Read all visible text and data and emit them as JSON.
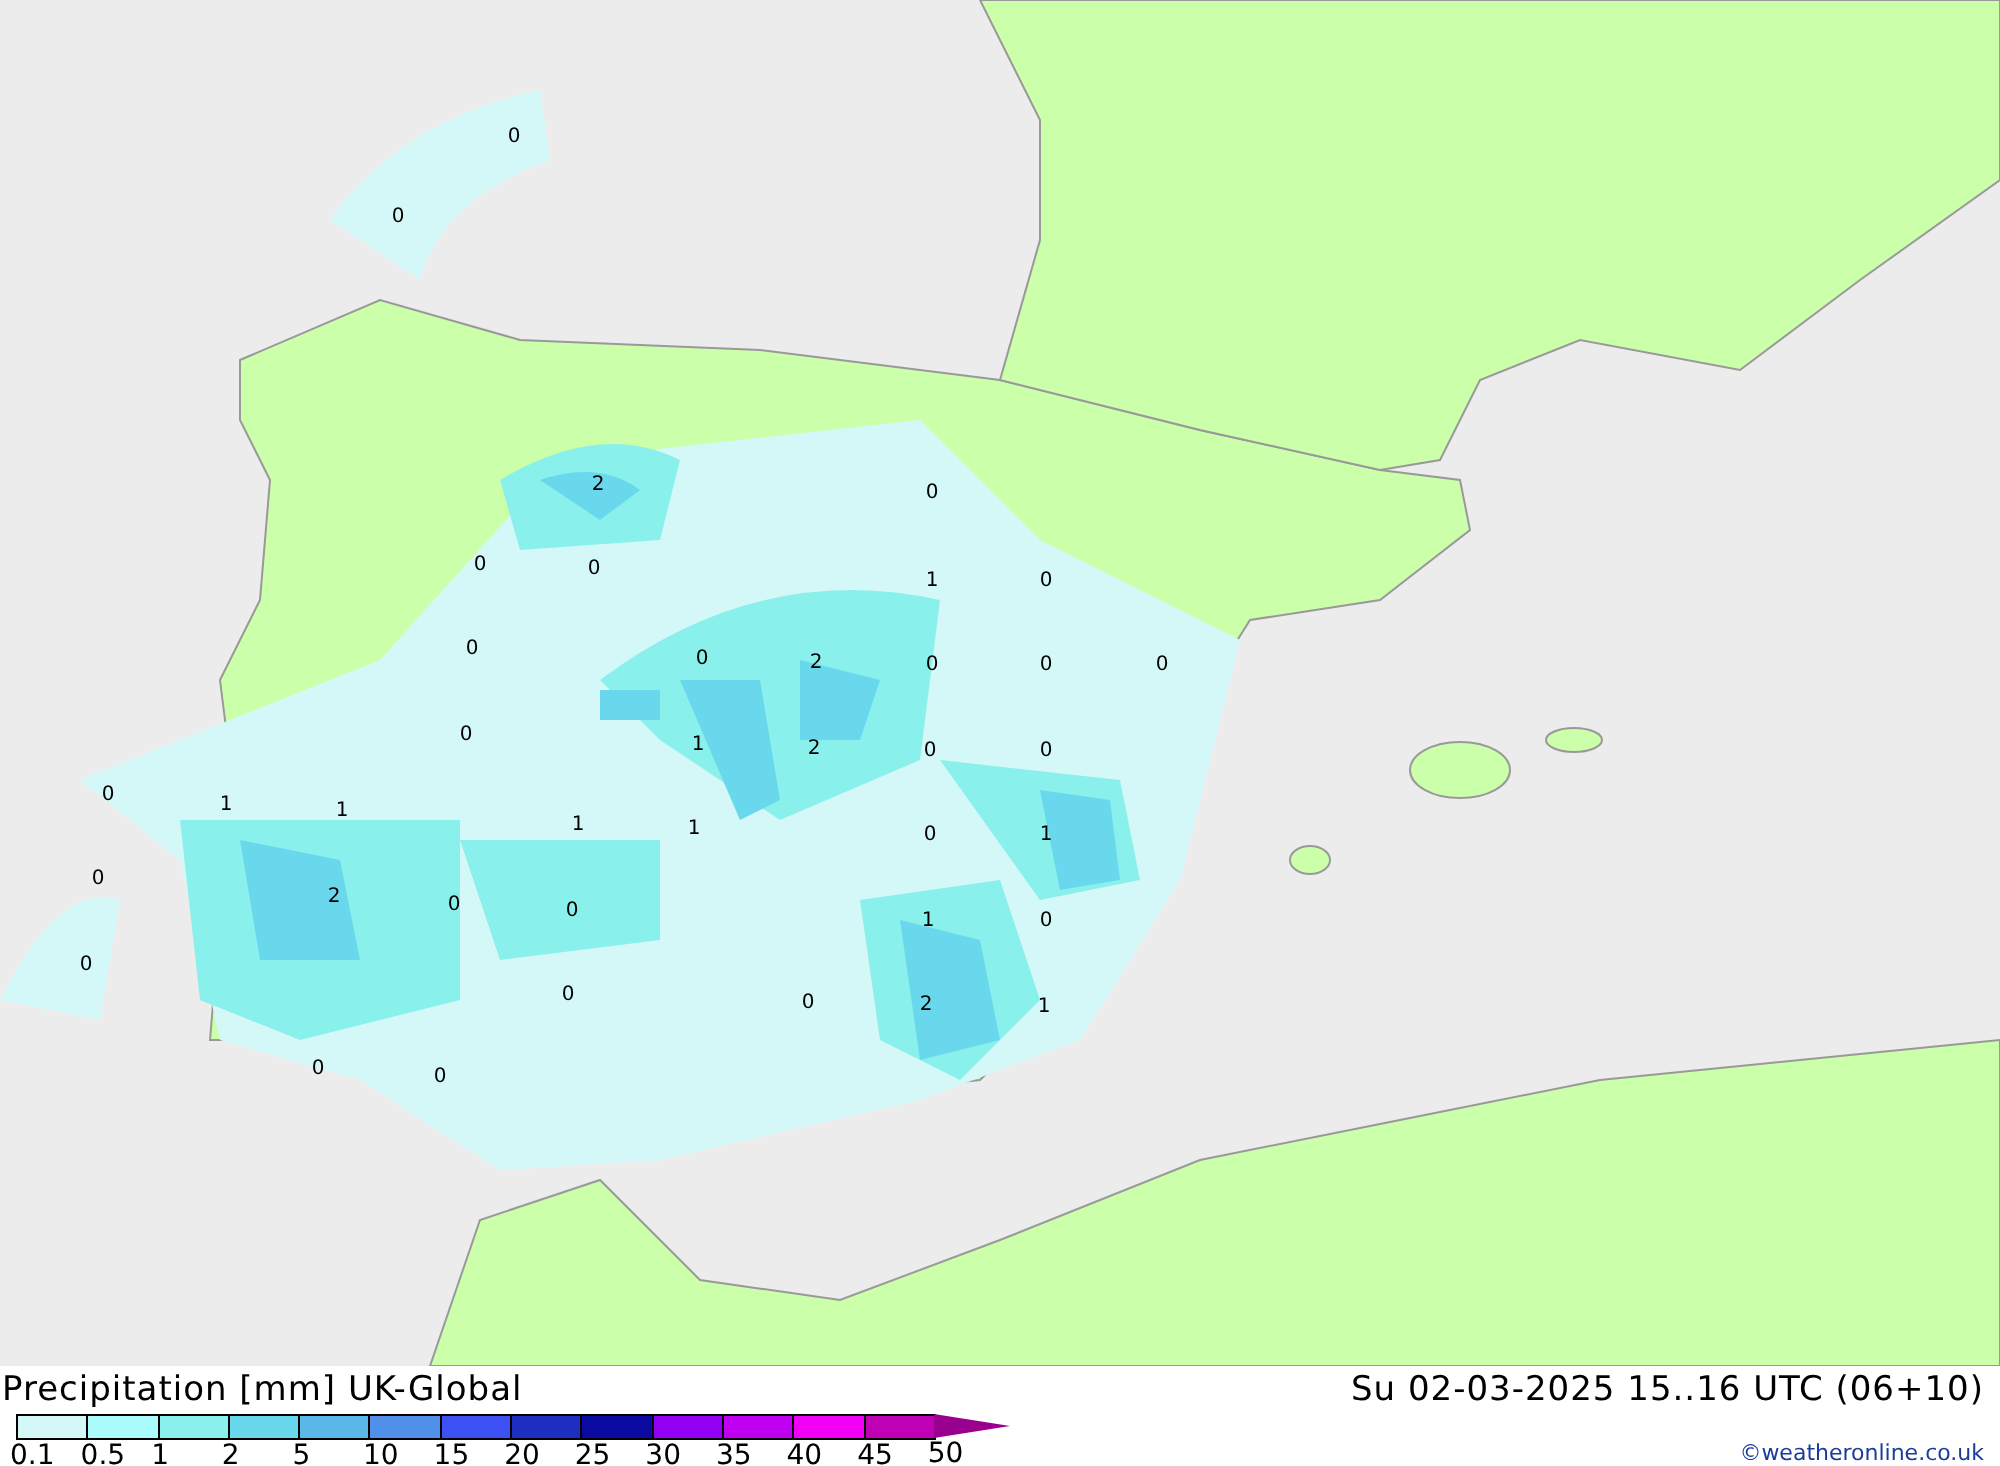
{
  "map": {
    "value_labels": [
      "0",
      "0",
      "2",
      "0",
      "0",
      "0",
      "1",
      "0",
      "0",
      "0",
      "2",
      "0",
      "0",
      "0",
      "0",
      "1",
      "2",
      "0",
      "0",
      "0",
      "1",
      "1",
      "1",
      "1",
      "0",
      "1",
      "0",
      "2",
      "0",
      "0",
      "1",
      "0",
      "0",
      "0",
      "0",
      "2",
      "1",
      "0",
      "0"
    ]
  },
  "title": "Precipitation [mm] UK-Global",
  "valid_time": "Su 02-03-2025 15..16 UTC (06+10)",
  "legend": [
    {
      "label": "0.1",
      "color": "#d4f8f8"
    },
    {
      "label": "0.5",
      "color": "#aafcfc"
    },
    {
      "label": "1",
      "color": "#8af0ec"
    },
    {
      "label": "2",
      "color": "#6ad8ec"
    },
    {
      "label": "5",
      "color": "#5ab8e8"
    },
    {
      "label": "10",
      "color": "#5090e8"
    },
    {
      "label": "15",
      "color": "#3c50f4"
    },
    {
      "label": "20",
      "color": "#1e2ec0"
    },
    {
      "label": "25",
      "color": "#0a0aa0"
    },
    {
      "label": "30",
      "color": "#9400f4"
    },
    {
      "label": "35",
      "color": "#c000f0"
    },
    {
      "label": "40",
      "color": "#f000f4"
    },
    {
      "label": "45",
      "color": "#c000b4"
    }
  ],
  "legend_end": "50",
  "credit": "©weatheronline.co.uk"
}
